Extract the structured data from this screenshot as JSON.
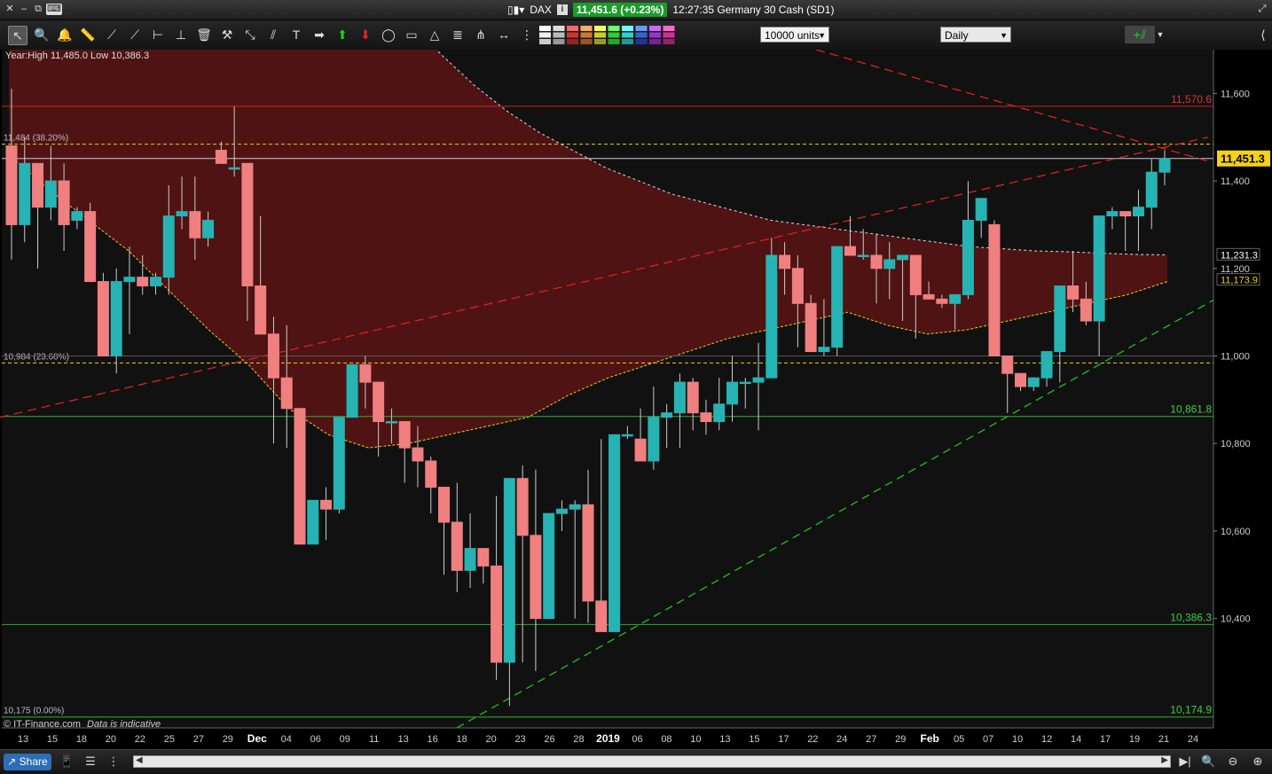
{
  "titlebar": {
    "instrument": "DAX",
    "price_change": "11,451.6 (+0.23%)",
    "time_label": "12:27:35 Germany 30 Cash (SD1)"
  },
  "toolbar": {
    "units_value": "10000 units",
    "timeframe_value": "Daily"
  },
  "chart": {
    "info_text": "Year:High 11,485.0 Low 10,386.3",
    "watermark": "© IT-Finance.com",
    "disclaimer": "Data is indicative",
    "colors": {
      "background": "#000000",
      "bull": "#26b3b3",
      "bear": "#f07f80",
      "resistance": "#e03030",
      "support": "#30c030",
      "fib": "#e8d020",
      "band": "#5a1414"
    }
  },
  "chart_data": {
    "type": "candlestick",
    "y_range": [
      10150,
      11700
    ],
    "y_ticks": [
      "11,600",
      "11,400",
      "11,200",
      "11,000",
      "10,800",
      "10,600",
      "10,400"
    ],
    "x_labels": [
      "13",
      "15",
      "18",
      "20",
      "22",
      "25",
      "27",
      "29",
      "Dec",
      "04",
      "06",
      "09",
      "11",
      "13",
      "16",
      "18",
      "20",
      "23",
      "26",
      "28",
      "2019",
      "06",
      "08",
      "10",
      "13",
      "15",
      "17",
      "22",
      "24",
      "27",
      "29",
      "Feb",
      "05",
      "07",
      "10",
      "12",
      "14",
      "17",
      "19",
      "21",
      "24"
    ],
    "current_price": "11,451.3",
    "price_badges": [
      {
        "label": "11,231.3",
        "value": 11231.3
      },
      {
        "label": "11,173.9",
        "value": 11173.9
      }
    ],
    "horizontal_levels": [
      {
        "label": "11,570.6",
        "value": 11570.6,
        "color": "red"
      },
      {
        "label": "10,861.8",
        "value": 10861.8,
        "color": "green"
      },
      {
        "label": "10,386.3",
        "value": 10386.3,
        "color": "green"
      },
      {
        "label": "10,174.9",
        "value": 10174.9,
        "color": "green"
      }
    ],
    "fib_levels": [
      {
        "label": "11,484 (38.20%)",
        "value": 11484
      },
      {
        "label": "10,984 (23.60%)",
        "value": 10984
      },
      {
        "label": "10,175 (0.00%)",
        "value": 10175
      }
    ],
    "candles": [
      [
        11480,
        11610,
        11220,
        11300
      ],
      [
        11300,
        11500,
        11260,
        11440
      ],
      [
        11440,
        11420,
        11200,
        11340
      ],
      [
        11340,
        11480,
        11310,
        11400
      ],
      [
        11400,
        11440,
        11240,
        11300
      ],
      [
        11310,
        11340,
        11290,
        11330
      ],
      [
        11330,
        11350,
        11190,
        11170
      ],
      [
        11170,
        11190,
        11010,
        11000
      ],
      [
        11000,
        11200,
        10960,
        11170
      ],
      [
        11170,
        11250,
        11050,
        11180
      ],
      [
        11180,
        11230,
        11140,
        11160
      ],
      [
        11160,
        11190,
        11140,
        11180
      ],
      [
        11180,
        11390,
        11140,
        11320
      ],
      [
        11320,
        11410,
        11290,
        11330
      ],
      [
        11330,
        11410,
        11220,
        11270
      ],
      [
        11270,
        11330,
        11250,
        11310
      ],
      [
        11470,
        11490,
        11440,
        11440
      ],
      [
        11430,
        11570,
        11410,
        11430
      ],
      [
        11440,
        11430,
        11080,
        11160
      ],
      [
        11160,
        11320,
        11060,
        11050
      ],
      [
        11050,
        11090,
        10800,
        10950
      ],
      [
        10950,
        11070,
        10790,
        10880
      ],
      [
        10880,
        10820,
        10730,
        10570
      ],
      [
        10570,
        10650,
        10620,
        10670
      ],
      [
        10670,
        10700,
        10580,
        10650
      ],
      [
        10650,
        10800,
        10640,
        10860
      ],
      [
        10860,
        10980,
        10860,
        10980
      ],
      [
        10980,
        11000,
        10880,
        10940
      ],
      [
        10940,
        10940,
        10770,
        10850
      ],
      [
        10850,
        10880,
        10800,
        10850
      ],
      [
        10850,
        10850,
        10710,
        10790
      ],
      [
        10790,
        10840,
        10700,
        10760
      ],
      [
        10760,
        10770,
        10640,
        10700
      ],
      [
        10700,
        10690,
        10500,
        10620
      ],
      [
        10620,
        10710,
        10460,
        10510
      ],
      [
        10510,
        10640,
        10470,
        10560
      ],
      [
        10560,
        10550,
        10480,
        10520
      ],
      [
        10520,
        10680,
        10260,
        10300
      ],
      [
        10300,
        10720,
        10200,
        10720
      ],
      [
        10720,
        10750,
        10300,
        10590
      ],
      [
        10590,
        10740,
        10280,
        10400
      ],
      [
        10400,
        10640,
        10400,
        10640
      ],
      [
        10640,
        10670,
        10600,
        10650
      ],
      [
        10650,
        10670,
        10400,
        10660
      ],
      [
        10660,
        10740,
        10390,
        10440
      ],
      [
        10440,
        10810,
        10390,
        10370
      ],
      [
        10370,
        10820,
        10400,
        10820
      ],
      [
        10820,
        10840,
        10810,
        10820
      ],
      [
        10810,
        10880,
        10760,
        10760
      ],
      [
        10760,
        10930,
        10740,
        10860
      ],
      [
        10860,
        10890,
        10790,
        10870
      ],
      [
        10870,
        10960,
        10790,
        10940
      ],
      [
        10940,
        10950,
        10830,
        10870
      ],
      [
        10870,
        10900,
        10820,
        10850
      ],
      [
        10850,
        10950,
        10830,
        10890
      ],
      [
        10890,
        11000,
        10850,
        10940
      ],
      [
        10940,
        10950,
        10880,
        10940
      ],
      [
        10940,
        11030,
        10830,
        10950
      ],
      [
        10950,
        11270,
        10950,
        11230
      ],
      [
        11230,
        11260,
        11140,
        11200
      ],
      [
        11200,
        11230,
        11020,
        11120
      ],
      [
        11120,
        11140,
        11010,
        11010
      ],
      [
        11010,
        11130,
        11000,
        11020
      ],
      [
        11020,
        11220,
        11000,
        11250
      ],
      [
        11250,
        11320,
        11230,
        11230
      ],
      [
        11230,
        11290,
        11220,
        11230
      ],
      [
        11230,
        11280,
        11120,
        11200
      ],
      [
        11200,
        11260,
        11130,
        11220
      ],
      [
        11220,
        11230,
        11080,
        11230
      ],
      [
        11230,
        11230,
        11040,
        11140
      ],
      [
        11140,
        11170,
        11130,
        11130
      ],
      [
        11130,
        11140,
        11110,
        11120
      ],
      [
        11120,
        11140,
        11060,
        11140
      ],
      [
        11140,
        11400,
        11130,
        11310
      ],
      [
        11310,
        11360,
        11270,
        11360
      ],
      [
        11300,
        11310,
        11000,
        11000
      ],
      [
        11000,
        10960,
        10870,
        10960
      ],
      [
        10960,
        10950,
        10920,
        10930
      ],
      [
        10930,
        10920,
        10920,
        10950
      ],
      [
        10950,
        11010,
        10930,
        11010
      ],
      [
        11010,
        11090,
        10940,
        11160
      ],
      [
        11160,
        11240,
        11100,
        11130
      ],
      [
        11130,
        11170,
        11070,
        11080
      ],
      [
        11080,
        11320,
        11000,
        11320
      ],
      [
        11320,
        11340,
        11290,
        11330
      ],
      [
        11330,
        11330,
        11240,
        11320
      ],
      [
        11320,
        11380,
        11240,
        11340
      ],
      [
        11340,
        11450,
        11290,
        11420
      ],
      [
        11420,
        11470,
        11390,
        11451
      ]
    ],
    "candle_x_start": 13,
    "candle_spacing": 15.6,
    "moving_average_white": [
      11970,
      11880,
      11780,
      11690,
      11620,
      11560,
      11510,
      11470,
      11430,
      11400,
      11370,
      11350,
      11330,
      11310,
      11300,
      11290,
      11280,
      11270,
      11260,
      11250,
      11245,
      11240,
      11238,
      11235,
      11232,
      11231
    ],
    "band_upper": [
      11700,
      11700,
      11700,
      11700,
      11700,
      11700,
      11700,
      11700,
      11700,
      11700,
      11700,
      11690,
      11630,
      11540,
      11460,
      11380,
      11330,
      11290,
      11260,
      11250,
      11240,
      11230,
      11230,
      11220,
      11220,
      11210,
      11200,
      11190,
      11180,
      11180,
      11170,
      11170,
      11180,
      11190,
      11200,
      11210
    ],
    "band_lower": [
      11460,
      11380,
      11310,
      11240,
      11150,
      11060,
      10980,
      10880,
      10820,
      10790,
      10800,
      10820,
      10840,
      10860,
      10910,
      10950,
      10980,
      11010,
      11040,
      11060,
      11080,
      11100,
      11070,
      11050,
      11060,
      11080,
      11100,
      11120,
      11140,
      11170
    ],
    "trendline_red": {
      "from": [
        0,
        10860
      ],
      "to": [
        1362,
        11500
      ]
    },
    "trendline_red_down": {
      "from": [
        920,
        11700
      ],
      "to": [
        1362,
        11445
      ]
    },
    "trendline_green": {
      "from": [
        515,
        10150
      ],
      "to": [
        1370,
        11130
      ]
    }
  }
}
